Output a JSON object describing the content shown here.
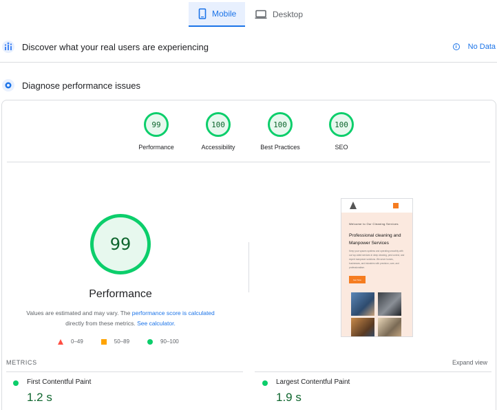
{
  "tabs": [
    {
      "label": "Mobile",
      "icon": "phone-icon",
      "active": true
    },
    {
      "label": "Desktop",
      "icon": "monitor-icon",
      "active": false
    }
  ],
  "discover": {
    "title": "Discover what your real users are experiencing",
    "icon": "users-chart-icon",
    "status": "No Data",
    "status_icon": "info-icon"
  },
  "diagnose": {
    "title": "Diagnose performance issues",
    "icon": "lighthouse-icon"
  },
  "categories": [
    {
      "score": "99",
      "label": "Performance"
    },
    {
      "score": "100",
      "label": "Accessibility"
    },
    {
      "score": "100",
      "label": "Best Practices"
    },
    {
      "score": "100",
      "label": "SEO"
    }
  ],
  "main_score": {
    "score": "99",
    "title": "Performance",
    "note_prefix": "Values are estimated and may vary. The ",
    "note_link1": "performance score is calculated",
    "note_middle": " directly from these metrics. ",
    "note_link2": "See calculator."
  },
  "legend": [
    {
      "range": "0–49",
      "shape": "triangle",
      "color": "#ff4e42"
    },
    {
      "range": "50–89",
      "shape": "square",
      "color": "#ffa400"
    },
    {
      "range": "90–100",
      "shape": "circle",
      "color": "#0cce6b"
    }
  ],
  "screenshot": {
    "welcome": "Welcome to Our Cleaning Services",
    "headline": "Professional cleaning and Manpower Services",
    "paragraph": "Keep your spaces spotless and operating smoothly with our top-rated services in deep cleaning, pest control, and expert manpower solutions. We serve homes, businesses, and industries with precision, care, and professionalism.",
    "cta": "Get Now"
  },
  "metrics": {
    "label": "METRICS",
    "expand": "Expand view",
    "items": [
      {
        "name": "First Contentful Paint",
        "value": "1.2 s"
      },
      {
        "name": "Largest Contentful Paint",
        "value": "1.9 s"
      }
    ]
  },
  "colors": {
    "pass": "#0cce6b",
    "pass_text": "#0d652d",
    "accent": "#1a73e8"
  }
}
